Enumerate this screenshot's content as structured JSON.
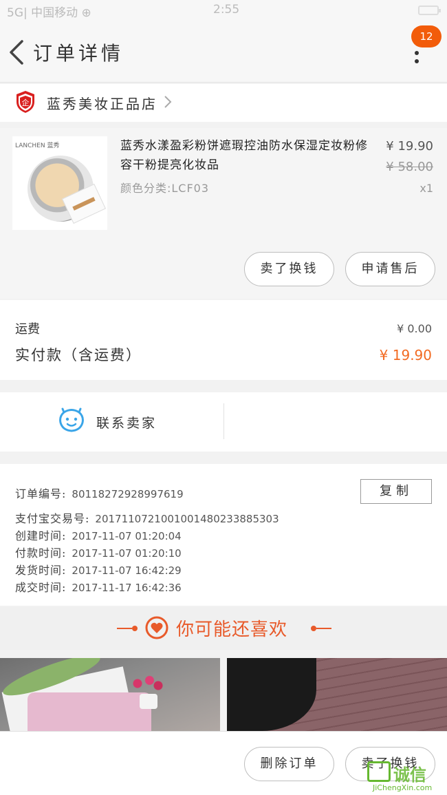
{
  "status_bar": {
    "signal": "5G| 中国移动 ⊕",
    "time": "2:55"
  },
  "navbar": {
    "title": "订单详情",
    "badge_count": "12"
  },
  "shop": {
    "name": "蓝秀美妆正品店"
  },
  "product": {
    "thumb_brand": "LANCHEN 蓝秀",
    "title": "蓝秀水漾盈彩粉饼遮瑕控油防水保湿定妆粉修容干粉提亮化妆品",
    "variant": "颜色分类:LCF03",
    "price": "¥ 19.90",
    "original_price": "¥ 58.00",
    "quantity": "x1",
    "sell_button": "卖了换钱",
    "aftersale_button": "申请售后"
  },
  "fees": {
    "shipping_label": "运费",
    "shipping_value": "¥ 0.00",
    "paid_label": "实付款（含运费）",
    "paid_value": "¥ 19.90"
  },
  "contact": {
    "label": "联系卖家"
  },
  "order_info": {
    "order_no_label": "订单编号:",
    "order_no": "80118272928997619",
    "copy_button": "复制",
    "alipay_label": "支付宝交易号:",
    "alipay_no": "2017110721001001480233885303",
    "created_label": "创建时间:",
    "created": "2017-11-07 01:20:04",
    "paid_time_label": "付款时间:",
    "paid_time": "2017-11-07 01:20:10",
    "shipped_label": "发货时间:",
    "shipped": "2017-11-07 16:42:29",
    "completed_label": "成交时间:",
    "completed": "2017-11-17 16:42:36"
  },
  "recommend": {
    "title": "你可能还喜欢"
  },
  "bottom": {
    "delete_button": "删除订单",
    "sell_button": "卖了换钱"
  },
  "watermark": {
    "text_cn": "诚信",
    "text_en": "JiChengXin.com"
  },
  "colors": {
    "accent": "#f26a21",
    "badge": "#f25c0a",
    "contact_icon": "#3aa5e8",
    "recommend": "#e85a2a"
  }
}
